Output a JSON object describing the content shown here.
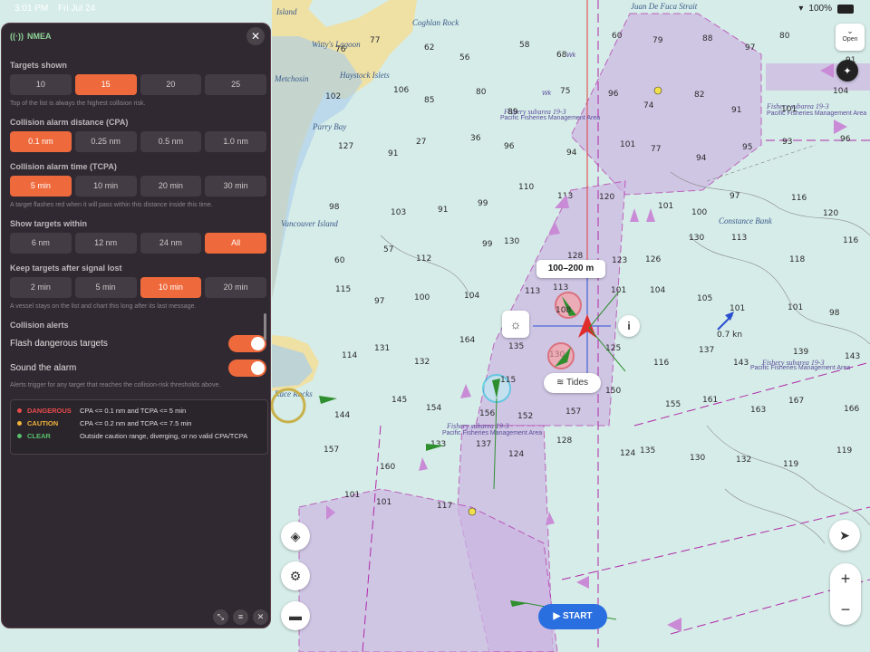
{
  "status_bar": {
    "time": "3:01 PM",
    "date": "Fri Jul 24",
    "battery": "100%"
  },
  "panel": {
    "title": "NMEA",
    "sections": {
      "targets_shown": {
        "title": "Targets shown",
        "options": [
          "10",
          "15",
          "20",
          "25"
        ],
        "selected": 1,
        "hint": "Top of the list is always the highest collision risk."
      },
      "cpa": {
        "title": "Collision alarm distance (CPA)",
        "options": [
          "0.1 nm",
          "0.25 nm",
          "0.5 nm",
          "1.0 nm"
        ],
        "selected": 0
      },
      "tcpa": {
        "title": "Collision alarm time (TCPA)",
        "options": [
          "5 min",
          "10 min",
          "20 min",
          "30 min"
        ],
        "selected": 0,
        "hint": "A target flashes red when it will pass within this distance inside this time."
      },
      "within": {
        "title": "Show targets within",
        "options": [
          "6 nm",
          "12 nm",
          "24 nm",
          "All"
        ],
        "selected": 3
      },
      "keep": {
        "title": "Keep targets after signal lost",
        "options": [
          "2 min",
          "5 min",
          "10 min",
          "20 min"
        ],
        "selected": 2,
        "hint": "A vessel stays on the list and chart this long after its last message."
      }
    },
    "alerts": {
      "title": "Collision alerts",
      "flash_label": "Flash dangerous targets",
      "flash_on": true,
      "sound_label": "Sound the alarm",
      "sound_on": true,
      "hint": "Alerts trigger for any target that reaches the collision-risk thresholds above."
    },
    "legend": [
      {
        "name": "DANGEROUS",
        "color": "#e74c4c",
        "desc": "CPA <= 0.1 nm and TCPA <= 5 min"
      },
      {
        "name": "CAUTION",
        "color": "#f0b43c",
        "desc": "CPA <= 0.2 nm and TCPA <= 7.5 min"
      },
      {
        "name": "CLEAR",
        "color": "#58c06a",
        "desc": "Outside caution range, diverging, or no valid CPA/TCPA"
      }
    ]
  },
  "map": {
    "range_label": "100–200 m",
    "tides_label": "Tides",
    "start_label": "START",
    "open_label": "Open",
    "info_label": "i",
    "speed_label": "0.7 kn",
    "place_names": [
      "Island",
      "Coghlan Rock",
      "Juan De Fuca Strait",
      "Witty's Lagoon",
      "Haystock Islets",
      "Metchosin",
      "Parry Bay",
      "Vancouver Island",
      "Race Rocks",
      "Constance Bank"
    ],
    "zone_titles": [
      "Fishery subarea 19-3",
      "Fishery subarea 19-3",
      "Fishery subarea 19-3",
      "Fishery subarea 19-3"
    ],
    "zone_subtitles": [
      "Pacific Fisheries Management Area",
      "Pacific Fisheries Management Area",
      "Pacific Fisheries Management Area",
      "Pacific Fisheries Management Area"
    ],
    "wk_labels": [
      "Wk",
      "Wk"
    ],
    "target_labels": [
      "108",
      "115"
    ],
    "depth_soundings": [
      "76",
      "77",
      "62",
      "56",
      "58",
      "68",
      "60",
      "79",
      "88",
      "97",
      "80",
      "91",
      "102",
      "106",
      "85",
      "80",
      "89",
      "75",
      "96",
      "74",
      "82",
      "91",
      "101",
      "104",
      "127",
      "91",
      "27",
      "36",
      "96",
      "94",
      "101",
      "77",
      "94",
      "95",
      "93",
      "96",
      "98",
      "103",
      "91",
      "99",
      "110",
      "113",
      "120",
      "101",
      "100",
      "97",
      "116",
      "120",
      "60",
      "57",
      "112",
      "99",
      "130",
      "128",
      "123",
      "126",
      "130",
      "113",
      "118",
      "116",
      "115",
      "97",
      "100",
      "104",
      "113",
      "113",
      "101",
      "104",
      "105",
      "101",
      "101",
      "98",
      "114",
      "131",
      "132",
      "164",
      "135",
      "130",
      "125",
      "116",
      "137",
      "143",
      "139",
      "143",
      "144",
      "145",
      "154",
      "156",
      "152",
      "157",
      "150",
      "155",
      "161",
      "163",
      "167",
      "166",
      "157",
      "160",
      "133",
      "137",
      "124",
      "128",
      "124",
      "135",
      "130",
      "132",
      "119",
      "119",
      "101",
      "101",
      "117"
    ]
  }
}
